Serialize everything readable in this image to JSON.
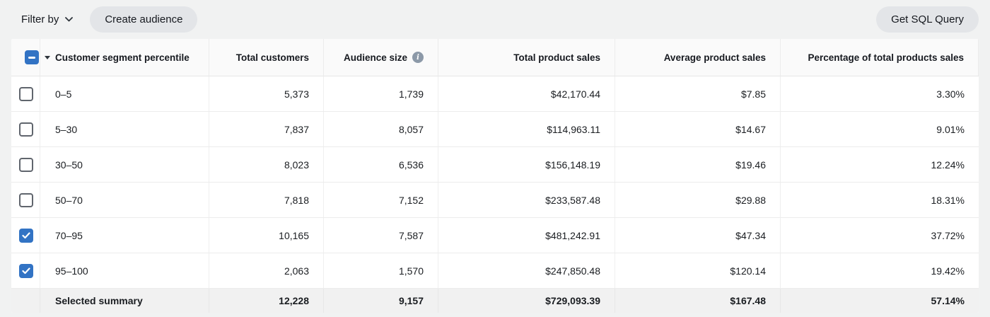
{
  "toolbar": {
    "filter_by_label": "Filter by",
    "create_audience_label": "Create audience",
    "get_sql_query_label": "Get SQL Query"
  },
  "colors": {
    "accent_blue": "#3273c4",
    "summary_bg": "#f1f1f1",
    "toolbar_bg": "#f1f2f2"
  },
  "selection": {
    "header_checkbox_state": "indeterminate",
    "selected_count": 2
  },
  "table": {
    "columns": [
      {
        "label": "Customer segment percentile",
        "align": "left"
      },
      {
        "label": "Total customers",
        "align": "right"
      },
      {
        "label": "Audience size",
        "align": "right",
        "has_info_icon": true
      },
      {
        "label": "Total product sales",
        "align": "right"
      },
      {
        "label": "Average product sales",
        "align": "right"
      },
      {
        "label": "Percentage of total products sales",
        "align": "right"
      }
    ],
    "rows": [
      {
        "percentile": "0–5",
        "total_customers": "5,373",
        "audience_size": "1,739",
        "total_product_sales": "$42,170.44",
        "average_product_sales": "$7.85",
        "percentage_of_total": "3.30%",
        "checked": false
      },
      {
        "percentile": "5–30",
        "total_customers": "7,837",
        "audience_size": "8,057",
        "total_product_sales": "$114,963.11",
        "average_product_sales": "$14.67",
        "percentage_of_total": "9.01%",
        "checked": false
      },
      {
        "percentile": "30–50",
        "total_customers": "8,023",
        "audience_size": "6,536",
        "total_product_sales": "$156,148.19",
        "average_product_sales": "$19.46",
        "percentage_of_total": "12.24%",
        "checked": false
      },
      {
        "percentile": "50–70",
        "total_customers": "7,818",
        "audience_size": "7,152",
        "total_product_sales": "$233,587.48",
        "average_product_sales": "$29.88",
        "percentage_of_total": "18.31%",
        "checked": false
      },
      {
        "percentile": "70–95",
        "total_customers": "10,165",
        "audience_size": "7,587",
        "total_product_sales": "$481,242.91",
        "average_product_sales": "$47.34",
        "percentage_of_total": "37.72%",
        "checked": true
      },
      {
        "percentile": "95–100",
        "total_customers": "2,063",
        "audience_size": "1,570",
        "total_product_sales": "$247,850.48",
        "average_product_sales": "$120.14",
        "percentage_of_total": "19.42%",
        "checked": true
      }
    ],
    "summary": {
      "label": "Selected summary",
      "total_customers": "12,228",
      "audience_size": "9,157",
      "total_product_sales": "$729,093.39",
      "average_product_sales": "$167.48",
      "percentage_of_total": "57.14%"
    }
  }
}
